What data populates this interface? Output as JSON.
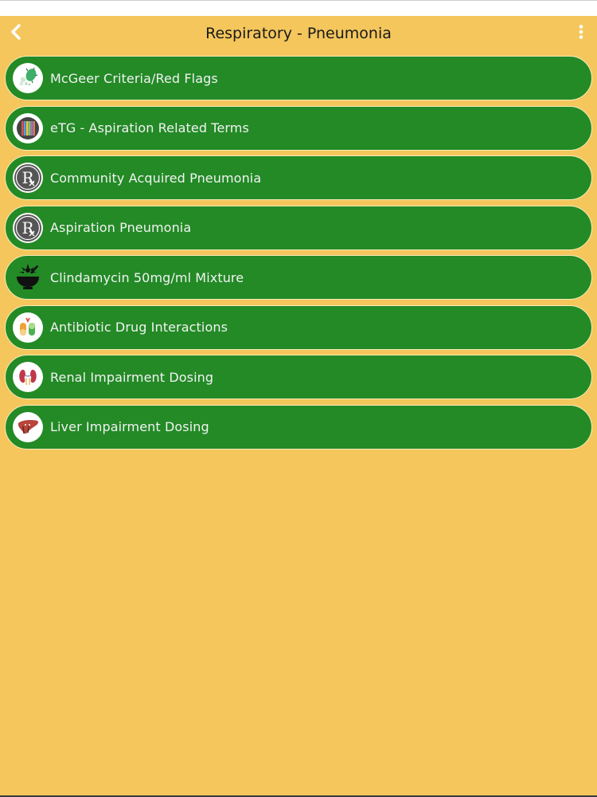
{
  "header": {
    "title": "Respiratory - Pneumonia",
    "back_icon": "chevron-left-icon",
    "more_icon": "more-vertical-icon"
  },
  "colors": {
    "background": "#f4c65c",
    "item_fill": "#238a26",
    "item_border": "#f6ecb9",
    "item_text": "#f2f2f2"
  },
  "items": [
    {
      "label": "McGeer Criteria/Red Flags",
      "icon": "germs-icon"
    },
    {
      "label": "eTG - Aspiration Related Terms",
      "icon": "books-icon"
    },
    {
      "label": "Community Acquired Pneumonia",
      "icon": "rx-icon"
    },
    {
      "label": "Aspiration Pneumonia",
      "icon": "rx-icon"
    },
    {
      "label": "Clindamycin 50mg/ml Mixture",
      "icon": "mortar-pestle-icon"
    },
    {
      "label": "Antibiotic Drug Interactions",
      "icon": "capsules-icon"
    },
    {
      "label": "Renal Impairment Dosing",
      "icon": "kidney-icon"
    },
    {
      "label": "Liver Impairment Dosing",
      "icon": "liver-icon"
    }
  ]
}
